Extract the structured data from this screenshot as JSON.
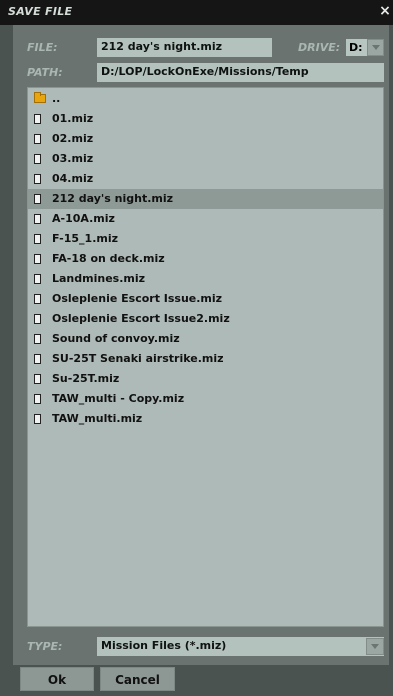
{
  "window": {
    "title": "SAVE FILE",
    "close_label": "×"
  },
  "file": {
    "label": "FILE:",
    "value": "212 day's night.miz"
  },
  "drive": {
    "label": "DRIVE:",
    "value": "D:"
  },
  "path": {
    "label": "PATH:",
    "value": "D:/LOP/LockOnExe/Missions/Temp"
  },
  "list": {
    "selected_index": 5,
    "items": [
      {
        "name": "..",
        "icon": "folder-icon"
      },
      {
        "name": "01.miz",
        "icon": "file-icon"
      },
      {
        "name": "02.miz",
        "icon": "file-icon"
      },
      {
        "name": "03.miz",
        "icon": "file-icon"
      },
      {
        "name": "04.miz",
        "icon": "file-icon"
      },
      {
        "name": "212 day's night.miz",
        "icon": "file-icon"
      },
      {
        "name": "A-10A.miz",
        "icon": "file-icon"
      },
      {
        "name": "F-15_1.miz",
        "icon": "file-icon"
      },
      {
        "name": "FA-18 on deck.miz",
        "icon": "file-icon"
      },
      {
        "name": "Landmines.miz",
        "icon": "file-icon"
      },
      {
        "name": "Osleplenie Escort Issue.miz",
        "icon": "file-icon"
      },
      {
        "name": "Osleplenie Escort Issue2.miz",
        "icon": "file-icon"
      },
      {
        "name": "Sound of convoy.miz",
        "icon": "file-icon"
      },
      {
        "name": "SU-25T Senaki airstrike.miz",
        "icon": "file-icon"
      },
      {
        "name": "Su-25T.miz",
        "icon": "file-icon"
      },
      {
        "name": "TAW_multi - Copy.miz",
        "icon": "file-icon"
      },
      {
        "name": "TAW_multi.miz",
        "icon": "file-icon"
      }
    ]
  },
  "type": {
    "label": "TYPE:",
    "value": "Mission Files (*.miz)"
  },
  "buttons": {
    "ok": "Ok",
    "cancel": "Cancel"
  }
}
